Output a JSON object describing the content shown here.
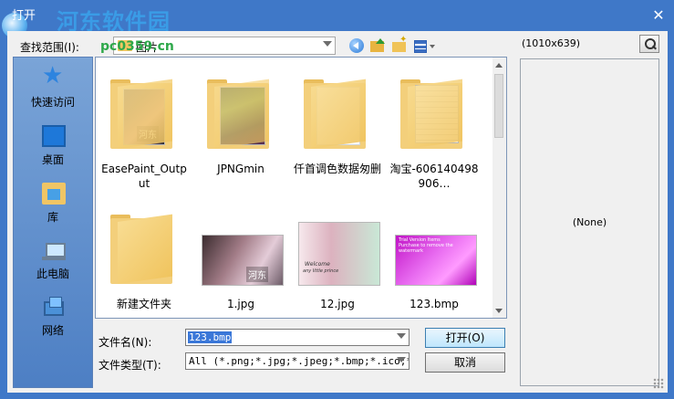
{
  "window": {
    "title": "打开"
  },
  "watermark": {
    "site_name": "河东软件园",
    "url": "pc0359.cn"
  },
  "lookin": {
    "label": "查找范围(I):",
    "value": "图片"
  },
  "toolbar": {
    "icons": [
      "back-icon",
      "up-folder-icon",
      "new-folder-icon",
      "view-menu-icon"
    ]
  },
  "places": [
    {
      "label": "快速访问",
      "icon": "star-icon"
    },
    {
      "label": "桌面",
      "icon": "desktop-icon"
    },
    {
      "label": "库",
      "icon": "library-icon"
    },
    {
      "label": "此电脑",
      "icon": "computer-icon"
    },
    {
      "label": "网络",
      "icon": "network-icon"
    }
  ],
  "files": [
    {
      "name": "EasePaint_Output",
      "type": "folder"
    },
    {
      "name": "JPNGmin",
      "type": "folder"
    },
    {
      "name": "仟首调色数据匆删",
      "type": "folder"
    },
    {
      "name": "淘宝-606140498906…",
      "type": "folder"
    },
    {
      "name": "新建文件夹",
      "type": "folder"
    },
    {
      "name": "1.jpg",
      "type": "image"
    },
    {
      "name": "12.jpg",
      "type": "image"
    },
    {
      "name": "123.bmp",
      "type": "image"
    }
  ],
  "thumb_text": {
    "hedong": "河东",
    "card_line1": "Welcome",
    "card_line2": "any little prince",
    "pink_line1": "Trial Version Items",
    "pink_line2": "Purchase to remove the watermark"
  },
  "filename": {
    "label": "文件名(N):",
    "value": "123.bmp"
  },
  "filetype": {
    "label": "文件类型(T):",
    "value": "All (*.png;*.jpg;*.jpeg;*.bmp;*.ico;*"
  },
  "buttons": {
    "open": "打开(O)",
    "cancel": "取消"
  },
  "preview": {
    "size": "(1010x639)",
    "none_text": "(None)"
  }
}
